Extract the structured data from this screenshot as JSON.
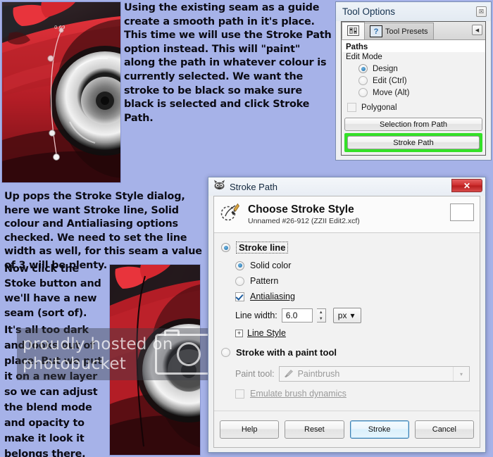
{
  "instructions": {
    "top": "Using the existing seam as a guide create a smooth path in it's place. This time we will use the Stroke Path option instead. This will \"paint\" along the path in whatever colour is currently selected. We want the stroke to be black so make sure black is selected and click Stroke Path.",
    "middle": "Up pops the Stroke Style dialog, here we want Stroke line, Solid colour and Antialiasing options checked. We need to set the line width as well, for this seam a value of 3 will be plenty.",
    "middle2": "Now click the Stoke button and we'll have a new seam (sort of).",
    "bottom": "It's all too dark and looks out of place. But we put it on a new layer so we can adjust the blend mode and opacity to make it look it belongs there."
  },
  "tool_options": {
    "title": "Tool Options",
    "close_glyph": "☒",
    "tabs": [
      {
        "label": "",
        "icon": "tool-options-icon",
        "active": true
      },
      {
        "label": "Tool Presets",
        "icon": "tool-presets-icon",
        "active": false
      }
    ],
    "collapse_glyph": "◀",
    "section_title": "Paths",
    "edit_mode_label": "Edit Mode",
    "edit_modes": [
      {
        "label": "Design",
        "selected": true
      },
      {
        "label": "Edit (Ctrl)",
        "selected": false
      },
      {
        "label": "Move (Alt)",
        "selected": false
      }
    ],
    "polygonal": {
      "label": "Polygonal",
      "checked": false
    },
    "selection_from_path": "Selection from Path",
    "stroke_path": "Stroke Path",
    "highlight_color": "#34e028"
  },
  "stroke_dialog": {
    "titlebar": "Stroke Path",
    "close_glyph": "✕",
    "heading": "Choose Stroke Style",
    "subheading": "Unnamed #26-912 (ZZII Edit2.xcf)",
    "stroke_line": {
      "label": "Stroke line",
      "selected": true
    },
    "solid_color": {
      "label": "Solid color",
      "selected": true
    },
    "pattern": {
      "label": "Pattern",
      "selected": false
    },
    "antialiasing": {
      "label": "Antialiasing",
      "checked": true
    },
    "line_width": {
      "label": "Line width:",
      "value": "6.0",
      "unit": "px",
      "unit_arrow": "▾",
      "spin_up": "▲",
      "spin_down": "▼"
    },
    "line_style": {
      "label": "Line Style",
      "expander": "+",
      "expanded": false
    },
    "stroke_with_paint_tool": {
      "label": "Stroke with a paint tool",
      "selected": false
    },
    "paint_tool": {
      "label": "Paint tool:",
      "value": "Paintbrush",
      "arrow": "▾",
      "enabled": false
    },
    "emulate_brush_dynamics": {
      "label": "Emulate brush dynamics",
      "checked": false,
      "enabled": false
    },
    "buttons": [
      {
        "label": "Help",
        "default": false
      },
      {
        "label": "Reset",
        "default": false
      },
      {
        "label": "Stroke",
        "default": true
      },
      {
        "label": "Cancel",
        "default": false
      }
    ]
  },
  "watermark": {
    "line1": "proudly hosted on",
    "line2": "photobucket",
    "icon": "camera-icon"
  },
  "canvas": {
    "top_image_name": "red-sports-car-with-path",
    "bottom_image_name": "red-sports-car-with-stroked-seam",
    "background_color": "#a6b2e8"
  }
}
